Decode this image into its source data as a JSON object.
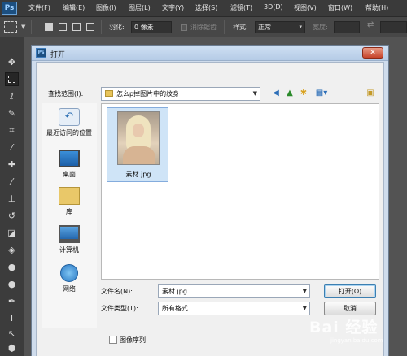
{
  "ps": {
    "logo": "Ps",
    "menus": [
      "文件(F)",
      "编辑(E)",
      "图像(I)",
      "图层(L)",
      "文字(Y)",
      "选择(S)",
      "滤镜(T)",
      "3D(D)",
      "视图(V)",
      "窗口(W)",
      "帮助(H)"
    ],
    "options": {
      "feather_label": "羽化:",
      "feather_value": "0 像素",
      "antialias_label": "消除锯齿",
      "style_label": "样式:",
      "style_value": "正常",
      "width_label": "宽度:"
    },
    "tool_icons": [
      "move-icon",
      "marquee-icon",
      "lasso-icon",
      "quick-select-icon",
      "crop-icon",
      "eyedropper-icon",
      "heal-icon",
      "brush-icon",
      "stamp-icon",
      "history-brush-icon",
      "eraser-icon",
      "bucket-icon",
      "blur-icon",
      "dodge-icon",
      "pen-icon",
      "type-icon",
      "path-select-icon",
      "shape-icon"
    ]
  },
  "dialog": {
    "title": "打开",
    "close_glyph": "✕",
    "look_in_label": "查找范围(I):",
    "look_in_value": "怎么p掉图片中的纹身",
    "places": [
      {
        "label": "最近访问的位置",
        "icon": "recent-places-icon"
      },
      {
        "label": "桌面",
        "icon": "desktop-icon"
      },
      {
        "label": "库",
        "icon": "libraries-icon"
      },
      {
        "label": "计算机",
        "icon": "computer-icon"
      },
      {
        "label": "网络",
        "icon": "network-icon"
      }
    ],
    "files": [
      {
        "name": "素材.jpg",
        "selected": true
      }
    ],
    "filename_label": "文件名(N):",
    "filename_value": "素材.jpg",
    "filetype_label": "文件类型(T):",
    "filetype_value": "所有格式",
    "open_button": "打开(O)",
    "cancel_button": "取消",
    "image_sequence_label": "图像序列"
  },
  "watermark": {
    "logo": "Bai 经验",
    "url": "jingyan.baidu.com"
  }
}
